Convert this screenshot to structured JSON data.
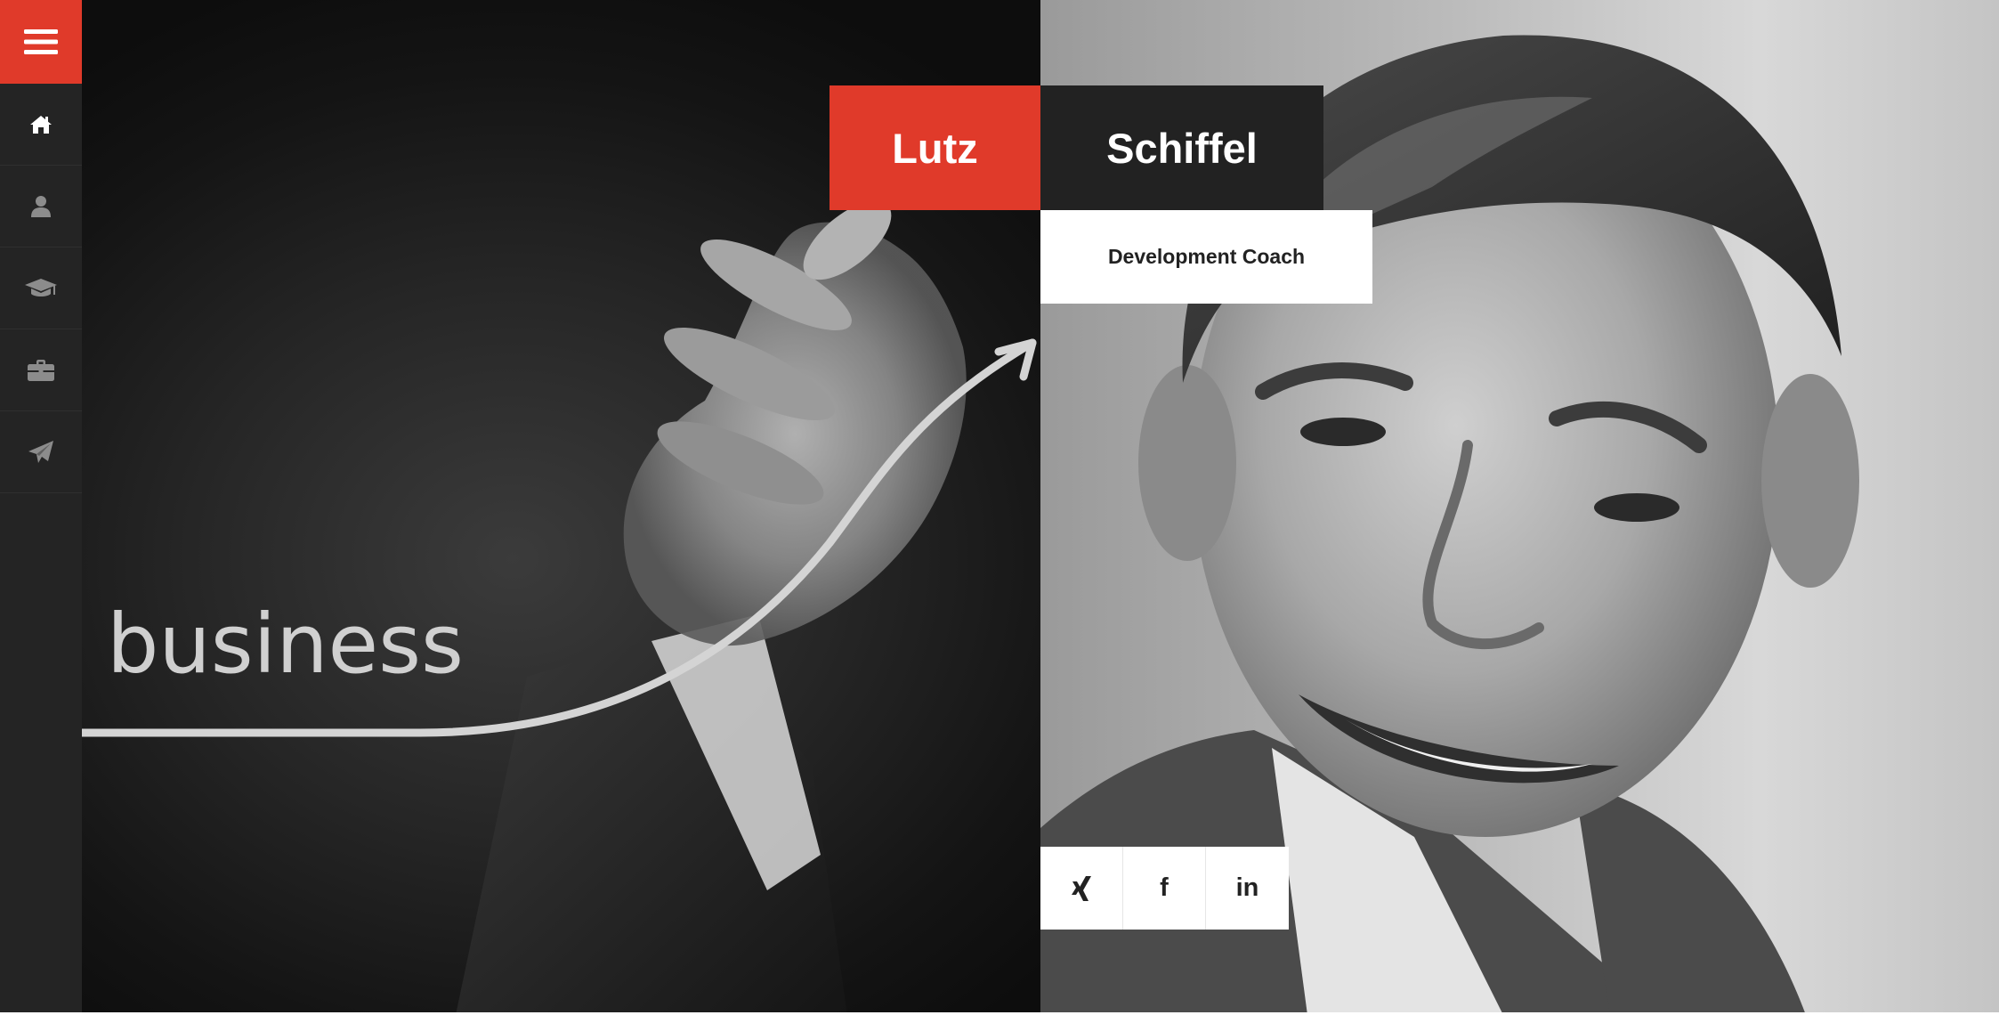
{
  "profile": {
    "first_name": "Lutz",
    "last_name": "Schiffel",
    "title": "Development Coach"
  },
  "hero": {
    "chalk_word": "business"
  },
  "sidebar": {
    "menu_icon": "hamburger-menu-icon",
    "items": [
      {
        "icon": "home-icon",
        "active": true
      },
      {
        "icon": "user-icon",
        "active": false
      },
      {
        "icon": "graduation-cap-icon",
        "active": false
      },
      {
        "icon": "briefcase-icon",
        "active": false
      },
      {
        "icon": "paper-plane-icon",
        "active": false
      }
    ]
  },
  "social": {
    "xing_glyph": "X",
    "facebook_glyph": "f",
    "linkedin_glyph": "in"
  },
  "colors": {
    "accent": "#e03a2a",
    "sidebar": "#242424",
    "dark_block": "#222222",
    "white": "#ffffff",
    "icon_active": "#ffffff",
    "icon_inactive": "#8c8c8c"
  }
}
